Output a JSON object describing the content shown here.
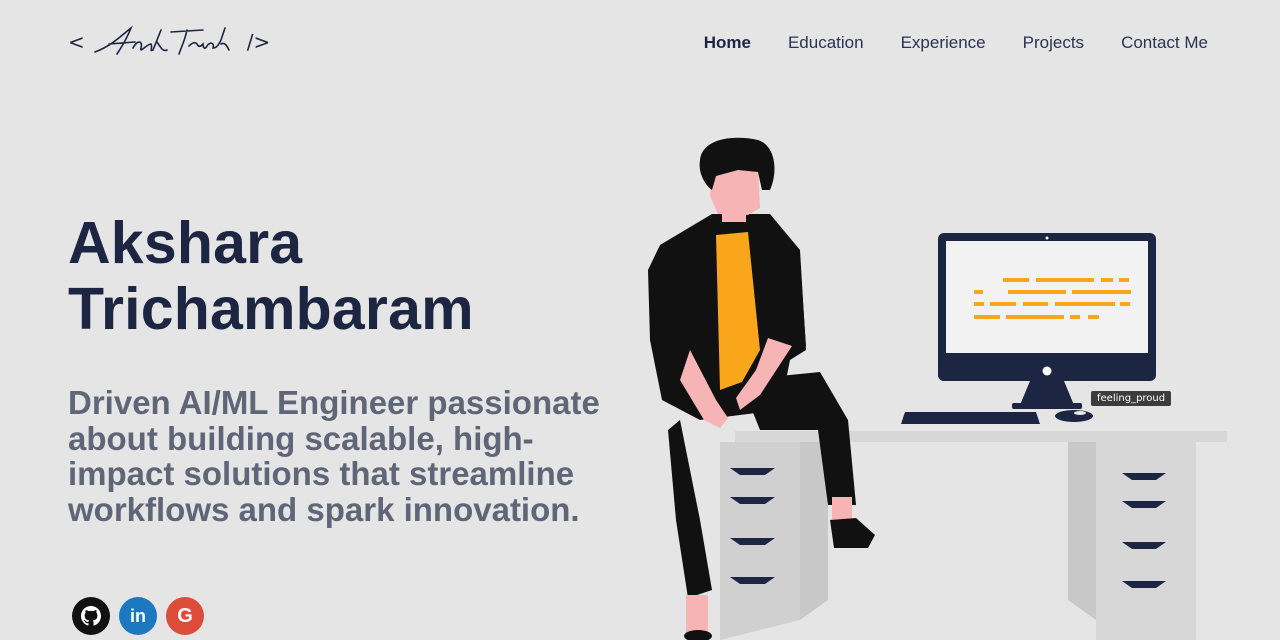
{
  "header": {
    "logo": {
      "open": "<",
      "script": "Aksh Trich",
      "close": "/>"
    },
    "nav": [
      {
        "label": "Home",
        "active": true
      },
      {
        "label": "Education",
        "active": false
      },
      {
        "label": "Experience",
        "active": false
      },
      {
        "label": "Projects",
        "active": false
      },
      {
        "label": "Contact Me",
        "active": false
      }
    ]
  },
  "hero": {
    "name_line1": "Akshara",
    "name_line2": "Trichambaram",
    "tagline": "Driven AI/ML Engineer passionate about building scalable, high-impact solutions that streamline workflows and spark innovation."
  },
  "socials": [
    {
      "icon": "github-icon",
      "glyph": ""
    },
    {
      "icon": "linkedin-icon",
      "glyph": "in"
    },
    {
      "icon": "google-icon",
      "glyph": "G"
    }
  ],
  "illustration": {
    "tooltip": "feeling_proud"
  },
  "colors": {
    "background": "#e5e5e6",
    "navy": "#1c2541",
    "accent_yellow": "#f9a61a",
    "skin": "#f7b4b4",
    "github": "#111111",
    "linkedin": "#1c79c0",
    "google": "#dd4b39"
  }
}
